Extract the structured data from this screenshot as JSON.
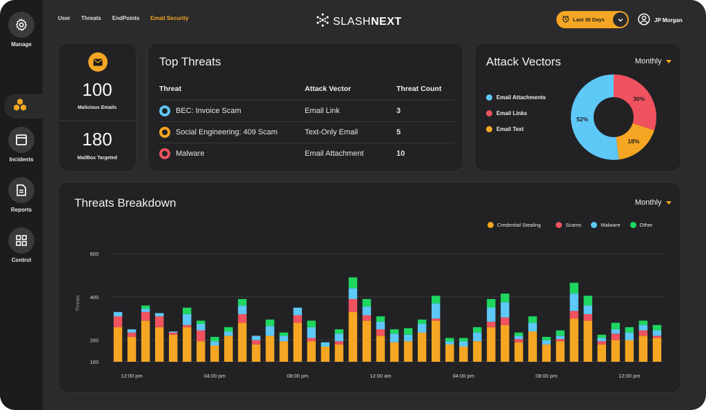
{
  "sidebar": {
    "items": [
      {
        "label": "Manage",
        "icon": "gear-icon"
      },
      {
        "label": "",
        "icon": "hexagon-cluster-icon"
      },
      {
        "label": "Incidents",
        "icon": "window-icon"
      },
      {
        "label": "Reports",
        "icon": "document-icon"
      },
      {
        "label": "Control",
        "icon": "grid-icon"
      }
    ]
  },
  "topnav": {
    "tabs": [
      "User",
      "Threats",
      "EndPoints",
      "Email Security"
    ],
    "active": "Email Security"
  },
  "logo": {
    "light": "SLASH",
    "bold": "NEXT"
  },
  "date_filter": {
    "label": "Last 30 Days"
  },
  "user": {
    "name": "JP Morgan"
  },
  "stats": [
    {
      "value": "100",
      "label": "Malicious Emails"
    },
    {
      "value": "180",
      "label": "MailBox Targeted"
    }
  ],
  "top_threats": {
    "title": "Top Threats",
    "headers": [
      "Threat",
      "Attack Vector",
      "Threat Count"
    ],
    "rows": [
      {
        "threat": "BEC: Invoice Scam",
        "vector": "Email Link",
        "count": "3",
        "color": "#5ec8f7"
      },
      {
        "threat": "Social Engineering: 409 Scam",
        "vector": "Text-Only Email",
        "count": "5",
        "color": "#f5a623"
      },
      {
        "threat": "Malware",
        "vector": "Email Attachment",
        "count": "10",
        "color": "#f0525f"
      }
    ]
  },
  "attack_vectors": {
    "title": "Attack Vectors",
    "period": "Monthly",
    "legend": [
      {
        "name": "Email Attachments",
        "color": "#5ec8f7"
      },
      {
        "name": "Email Links",
        "color": "#f0525f"
      },
      {
        "name": "Email Text",
        "color": "#f5a623"
      }
    ]
  },
  "breakdown": {
    "title": "Threats Breakdown",
    "period": "Monthly",
    "ylabel": "Threats"
  },
  "colors": {
    "accent": "#f5a623",
    "scams": "#f0525f",
    "malware": "#5ec8f7",
    "other": "#1ed760"
  },
  "chart_data": [
    {
      "type": "pie",
      "categories": [
        "Email Attachments",
        "Email Links",
        "Email Text"
      ],
      "values": [
        52,
        30,
        18
      ],
      "labels": [
        "52%",
        "30%",
        "18%"
      ],
      "colors": [
        "#5ec8f7",
        "#f0525f",
        "#f5a623"
      ]
    },
    {
      "type": "bar",
      "stacked": true,
      "ylim": [
        100,
        600
      ],
      "yticks": [
        100,
        200,
        400,
        600
      ],
      "ylabel": "Threats",
      "xticks": [
        "12:00 pm",
        "04:00 pm",
        "08:00 pm",
        "12:00 am",
        "04:00 pm",
        "08:00 pm",
        "12:00 pm"
      ],
      "xtick_positions": [
        1,
        7,
        13,
        19,
        25,
        31,
        37
      ],
      "series": [
        {
          "name": "Credential Stealing",
          "color": "#f5a623",
          "values": [
            160,
            115,
            190,
            160,
            125,
            160,
            95,
            75,
            120,
            180,
            80,
            120,
            95,
            180,
            95,
            70,
            80,
            230,
            190,
            120,
            90,
            95,
            135,
            190,
            80,
            70,
            95,
            160,
            170,
            90,
            140,
            80,
            95,
            200,
            190,
            80,
            100,
            100,
            120,
            110
          ]
        },
        {
          "name": "Scams",
          "color": "#f0525f",
          "values": [
            50,
            20,
            40,
            50,
            10,
            10,
            50,
            0,
            0,
            40,
            20,
            0,
            0,
            35,
            15,
            0,
            15,
            60,
            25,
            30,
            0,
            0,
            0,
            10,
            0,
            0,
            0,
            25,
            35,
            15,
            0,
            0,
            10,
            35,
            30,
            15,
            30,
            0,
            25,
            10
          ]
        },
        {
          "name": "Malware",
          "color": "#5ec8f7",
          "values": [
            20,
            15,
            15,
            15,
            5,
            50,
            30,
            20,
            20,
            40,
            20,
            45,
            25,
            35,
            50,
            20,
            35,
            50,
            40,
            35,
            40,
            30,
            40,
            70,
            15,
            25,
            40,
            65,
            70,
            15,
            40,
            20,
            15,
            80,
            40,
            15,
            20,
            35,
            25,
            25
          ]
        },
        {
          "name": "Other",
          "color": "#1ed760",
          "values": [
            0,
            0,
            15,
            0,
            0,
            30,
            15,
            20,
            20,
            30,
            0,
            30,
            15,
            0,
            30,
            0,
            20,
            50,
            35,
            25,
            20,
            30,
            20,
            35,
            15,
            15,
            25,
            40,
            40,
            15,
            30,
            15,
            25,
            50,
            45,
            15,
            30,
            25,
            20,
            25
          ]
        }
      ]
    }
  ]
}
